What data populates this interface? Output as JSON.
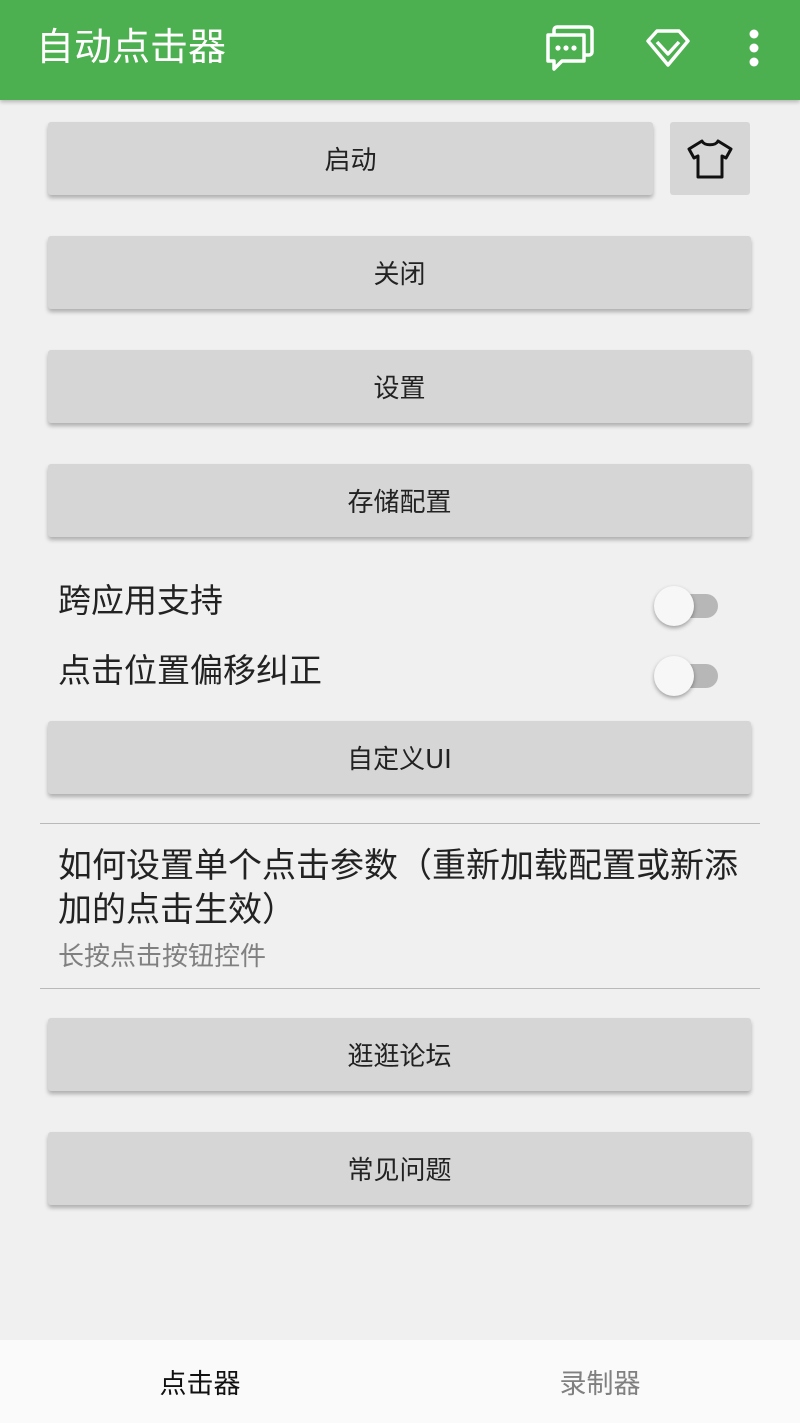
{
  "appbar": {
    "title": "自动点击器",
    "icons": [
      "chat-icon",
      "diamond-icon",
      "more-vert-icon"
    ]
  },
  "buttons": {
    "start": "启动",
    "close": "关闭",
    "settings": "设置",
    "store_config": "存储配置",
    "custom_ui": "自定义UI",
    "forum": "逛逛论坛",
    "faq": "常见问题"
  },
  "toggles": [
    {
      "label": "跨应用支持",
      "checked": false
    },
    {
      "label": "点击位置偏移纠正",
      "checked": false
    }
  ],
  "info": {
    "title": "如何设置单个点击参数（重新加载配置或新添加的点击生效）",
    "subtitle": "长按点击按钮控件"
  },
  "bottom_nav": [
    {
      "label": "点击器",
      "active": true
    },
    {
      "label": "录制器",
      "active": false
    }
  ],
  "colors": {
    "accent": "#4caf50",
    "button_bg": "#d6d6d6",
    "active_tab": "#111111",
    "inactive_tab": "#808080"
  }
}
